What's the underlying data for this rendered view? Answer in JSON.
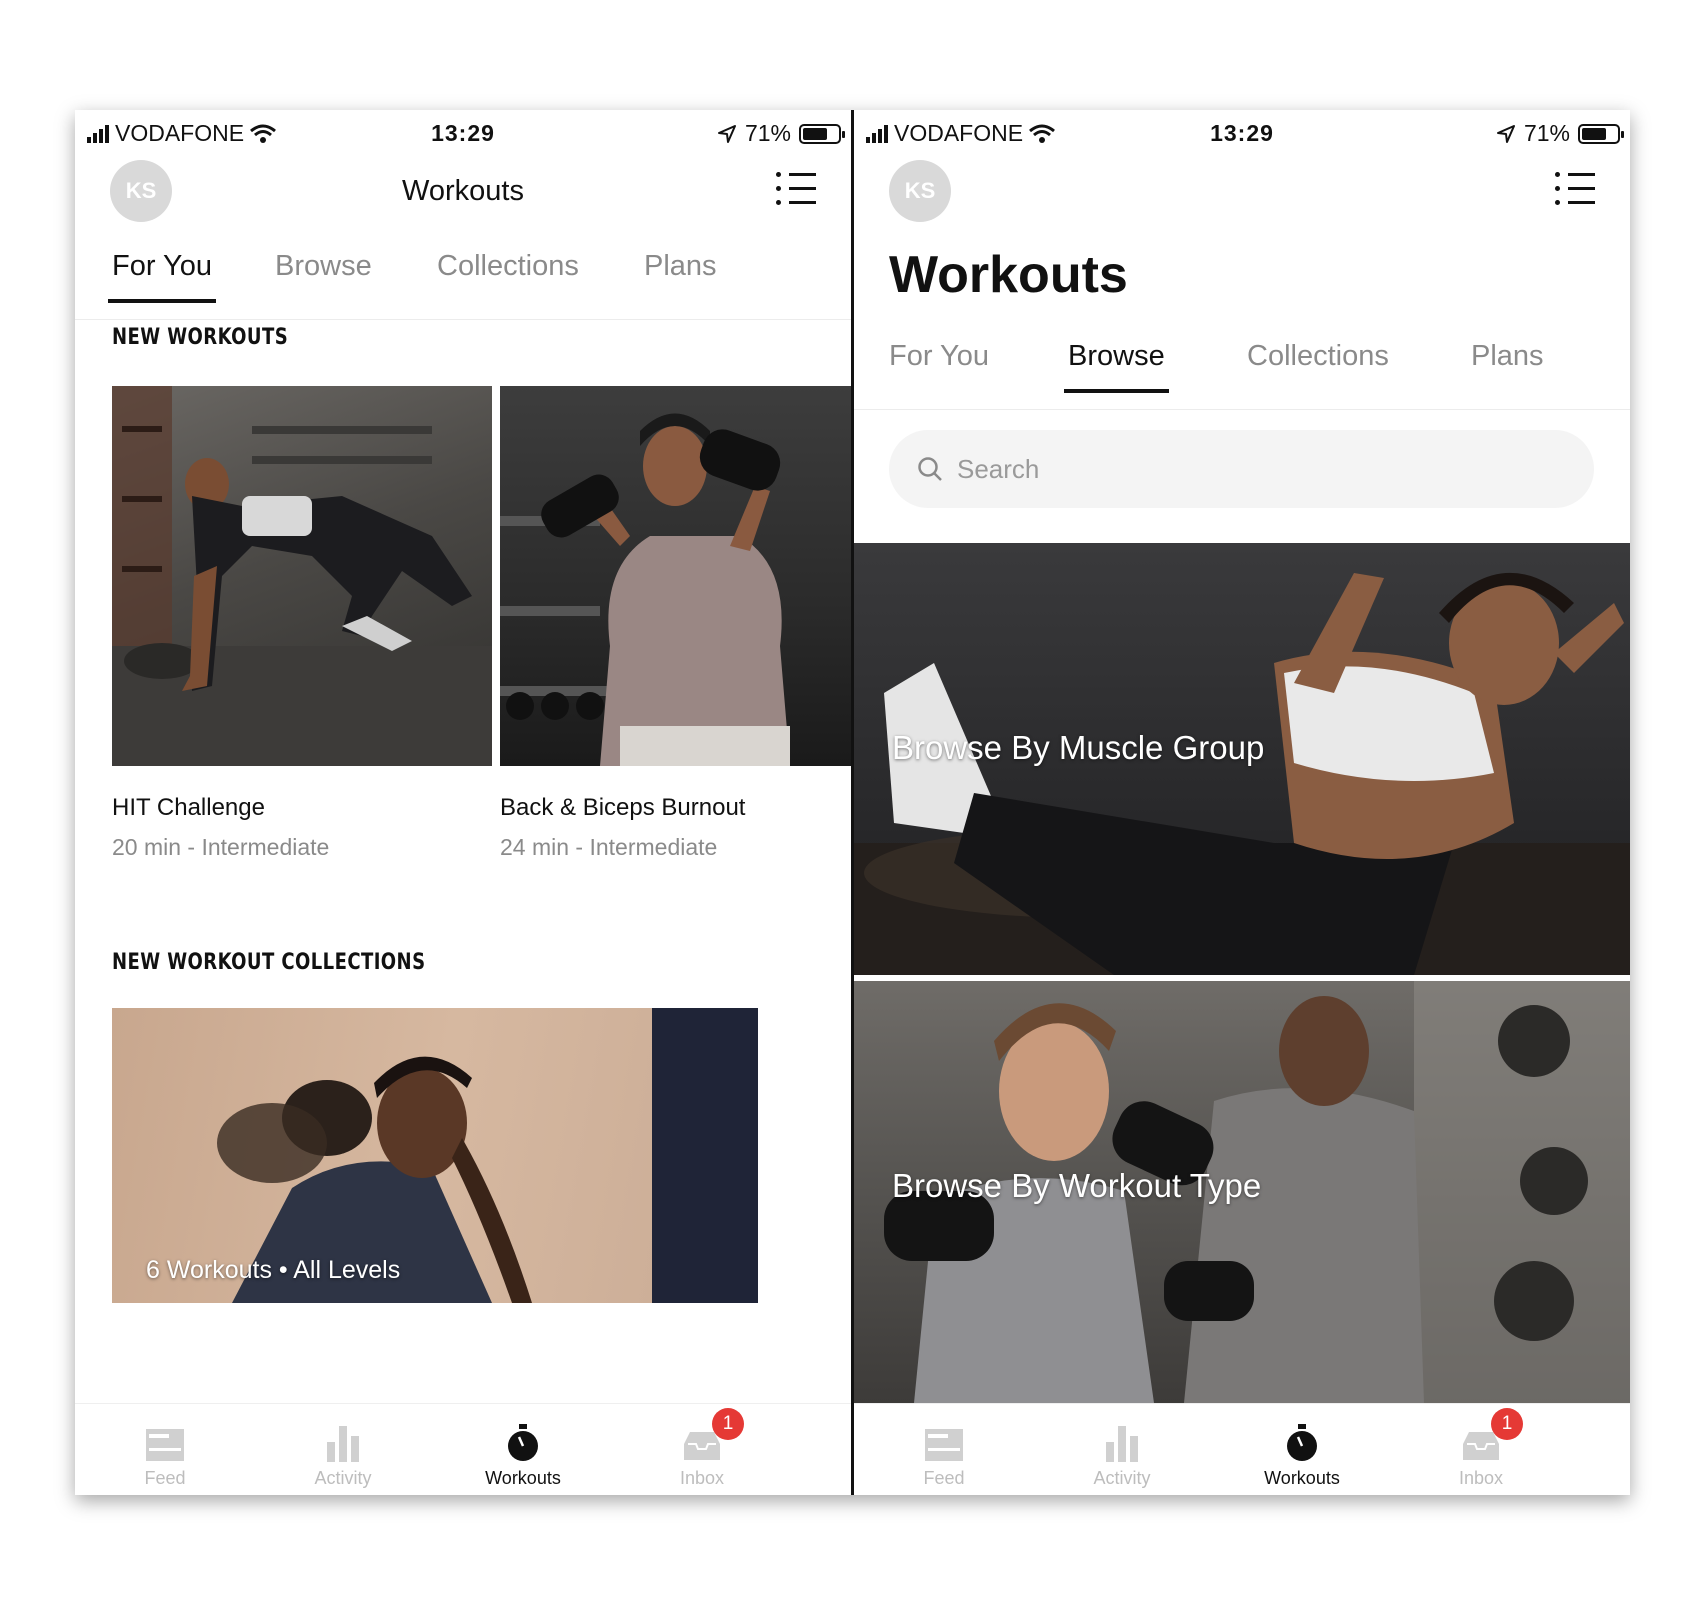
{
  "status": {
    "carrier": "VODAFONE",
    "time": "13:29",
    "battery": "71%",
    "battery_level": 0.71
  },
  "avatar_initials": "KS",
  "left": {
    "header_title": "Workouts",
    "tabs": [
      "For You",
      "Browse",
      "Collections",
      "Plans"
    ],
    "active_tab": "For You",
    "new_workouts_title": "NEW WORKOUTS",
    "workouts": [
      {
        "title": "HIT Challenge",
        "meta": "20 min - Intermediate"
      },
      {
        "title": "Back & Biceps Burnout",
        "meta": "24 min - Intermediate"
      }
    ],
    "collections_title": "NEW WORKOUT COLLECTIONS",
    "collection_caption": "6 Workouts • All Levels"
  },
  "right": {
    "page_title": "Workouts",
    "tabs": [
      "For You",
      "Browse",
      "Collections",
      "Plans"
    ],
    "active_tab": "Browse",
    "search_placeholder": "Search",
    "browse_cards": [
      "Browse By Muscle Group",
      "Browse By Workout Type"
    ]
  },
  "tabbar": {
    "items": [
      "Feed",
      "Activity",
      "Workouts",
      "Inbox"
    ],
    "active": "Workouts",
    "inbox_badge": "1"
  },
  "colors": {
    "accent": "#111111",
    "inactive": "#8a8a8a",
    "badge": "#e53935"
  }
}
